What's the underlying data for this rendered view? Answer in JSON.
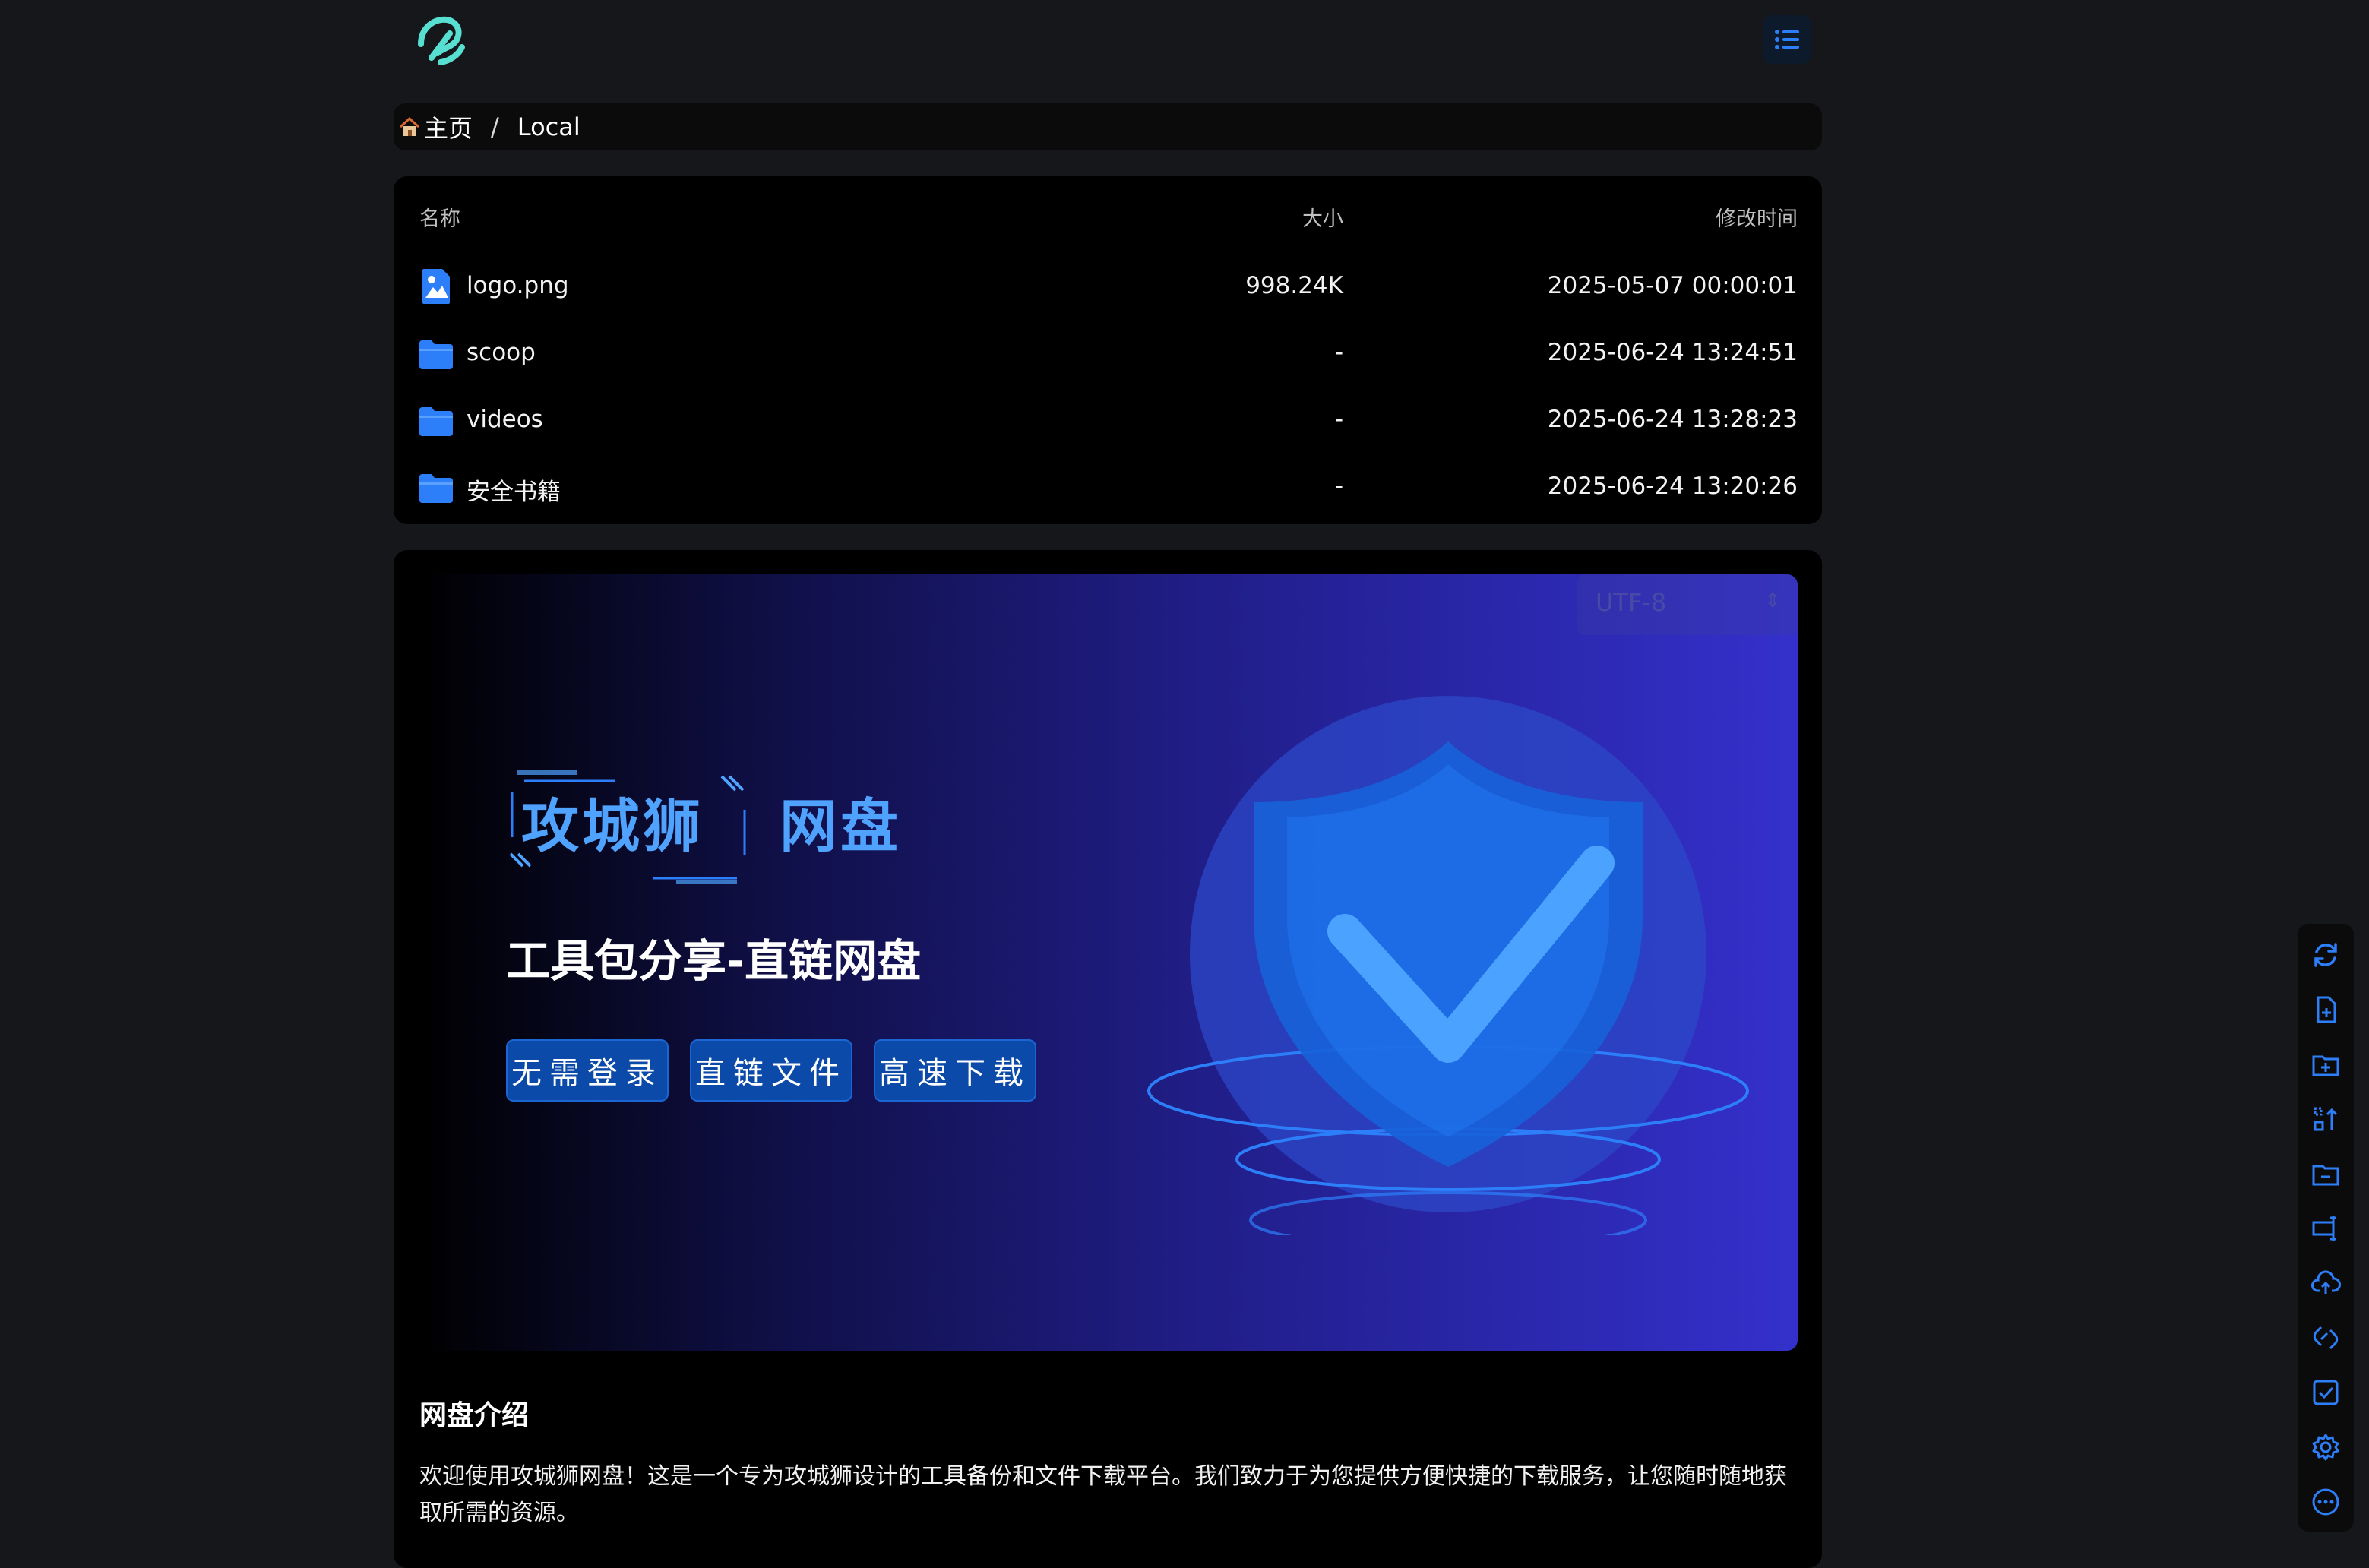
{
  "breadcrumb": {
    "home_label": "主页",
    "separator": "/",
    "current": "Local"
  },
  "file_list": {
    "columns": {
      "name": "名称",
      "size": "大小",
      "modified": "修改时间"
    },
    "rows": [
      {
        "type": "image-file",
        "name": "logo.png",
        "size": "998.24K",
        "modified": "2025-05-07 00:00:01"
      },
      {
        "type": "folder",
        "name": "scoop",
        "size": "-",
        "modified": "2025-06-24 13:24:51"
      },
      {
        "type": "folder",
        "name": "videos",
        "size": "-",
        "modified": "2025-06-24 13:28:23"
      },
      {
        "type": "folder",
        "name": "安全书籍",
        "size": "-",
        "modified": "2025-06-24 13:20:26"
      }
    ]
  },
  "readme": {
    "encoding": "UTF-8",
    "banner": {
      "brand_left": "攻城狮",
      "brand_right": "网盘",
      "tagline": "工具包分享-直链网盘",
      "pills": [
        "无需登录",
        "直链文件",
        "高速下载"
      ]
    },
    "intro_title": "网盘介绍",
    "intro_text": "欢迎使用攻城狮网盘！这是一个专为攻城狮设计的工具备份和文件下载平台。我们致力于为您提供方便快捷的下载服务，让您随时随地获取所需的资源。"
  },
  "toolbar": {
    "icons": [
      "refresh-icon",
      "new-file-icon",
      "new-folder-icon",
      "sort-icon",
      "folder-minus-icon",
      "batch-rename-icon",
      "upload-icon",
      "offline-download-icon",
      "select-icon",
      "settings-icon",
      "more-icon"
    ]
  },
  "colors": {
    "accent": "#2d7ff9",
    "background": "#16171a",
    "panel": "#000000"
  }
}
